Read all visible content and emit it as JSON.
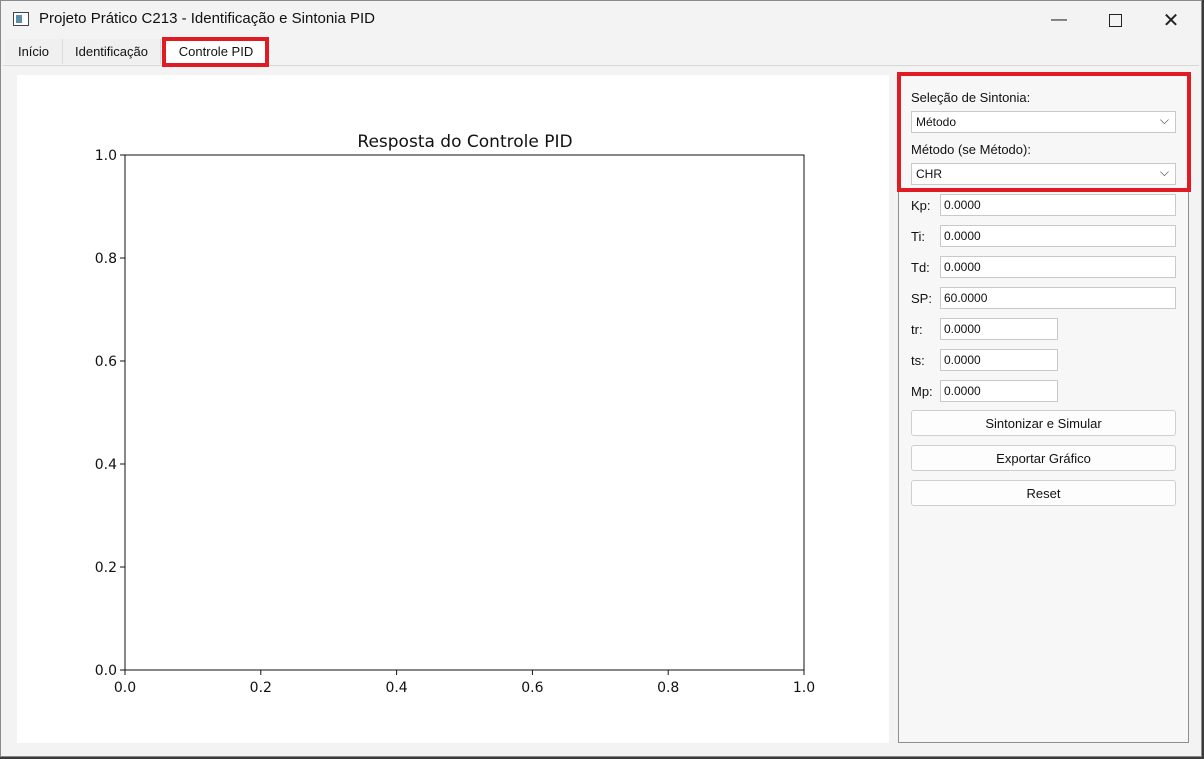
{
  "window": {
    "title": "Projeto Prático C213 - Identificação e Sintonia PID"
  },
  "tabs": [
    "Início",
    "Identificação",
    "Controle PID"
  ],
  "panel": {
    "selection_label": "Seleção de Sintonia:",
    "selection_value": "Método",
    "method_label": "Método (se Método):",
    "method_value": "CHR",
    "params": [
      {
        "label": "Kp:",
        "value": "0.0000"
      },
      {
        "label": "Ti:",
        "value": "0.0000"
      },
      {
        "label": "Td:",
        "value": "0.0000"
      },
      {
        "label": "SP:",
        "value": "60.0000"
      }
    ],
    "metrics": [
      {
        "label": "tr:",
        "value": "0.0000"
      },
      {
        "label": "ts:",
        "value": "0.0000"
      },
      {
        "label": "Mp:",
        "value": "0.0000"
      }
    ],
    "buttons": [
      "Sintonizar e Simular",
      "Exportar Gráfico",
      "Reset"
    ]
  },
  "chart_data": {
    "type": "line",
    "title": "Resposta do Controle PID",
    "series": [],
    "xlim": [
      0.0,
      1.0
    ],
    "ylim": [
      0.0,
      1.0
    ],
    "xticks": [
      "0.0",
      "0.2",
      "0.4",
      "0.6",
      "0.8",
      "1.0"
    ],
    "yticks": [
      "0.0",
      "0.2",
      "0.4",
      "0.6",
      "0.8",
      "1.0"
    ],
    "xlabel": "",
    "ylabel": "",
    "grid": false
  },
  "colors": {
    "highlight": "#e01b24"
  }
}
